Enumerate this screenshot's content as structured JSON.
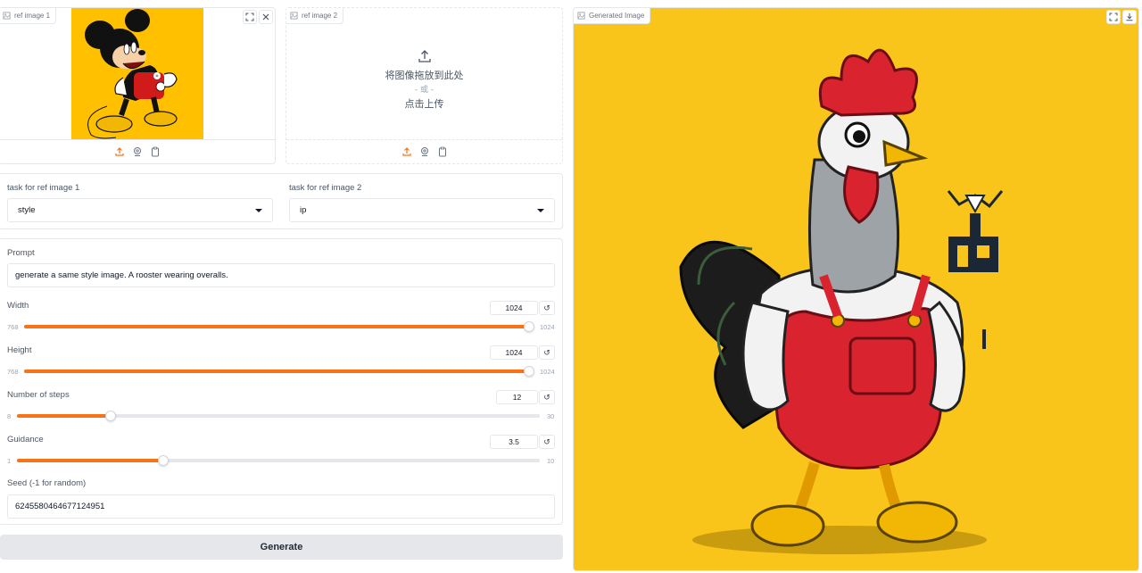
{
  "ref_image_1": {
    "label": "ref image 1"
  },
  "ref_image_2": {
    "label": "ref image 2",
    "drop_text": "将图像拖放到此处",
    "or_text": "- 或 -",
    "click_text": "点击上传"
  },
  "tasks": {
    "task1_label": "task for ref image 1",
    "task1_value": "style",
    "task2_label": "task for ref image 2",
    "task2_value": "ip"
  },
  "prompt": {
    "label": "Prompt",
    "value": "generate a same style image. A rooster wearing overalls."
  },
  "width": {
    "label": "Width",
    "value": "1024",
    "min": "768",
    "max": "1024",
    "fraction": 1.0
  },
  "height": {
    "label": "Height",
    "value": "1024",
    "min": "768",
    "max": "1024",
    "fraction": 1.0
  },
  "steps": {
    "label": "Number of steps",
    "value": "12",
    "min": "8",
    "max": "30",
    "fraction": 0.18
  },
  "guidance": {
    "label": "Guidance",
    "value": "3.5",
    "min": "1",
    "max": "10",
    "fraction": 0.28
  },
  "seed": {
    "label": "Seed (-1 for random)",
    "value": "6245580464677124951"
  },
  "generate": {
    "label": "Generate"
  },
  "output": {
    "label": "Generated Image"
  },
  "colors": {
    "accent": "#f97316",
    "yellow_bg": "#f9c51a",
    "mickey_bg": "#ffc000"
  },
  "icons": [
    "image-icon",
    "fullscreen-icon",
    "close-icon",
    "upload-icon",
    "webcam-icon",
    "clipboard-icon",
    "reset-icon",
    "download-icon",
    "caret-down-icon"
  ]
}
